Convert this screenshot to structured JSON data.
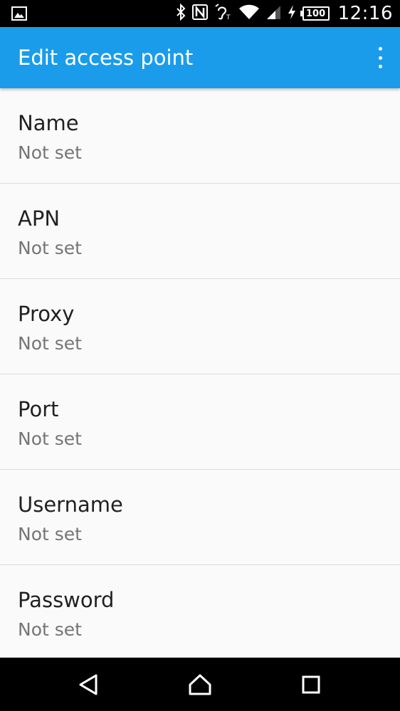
{
  "status_bar": {
    "time": "12:16",
    "battery": "100",
    "icons": [
      "image-icon",
      "bluetooth-icon",
      "nfc-icon",
      "hearing-aid-icon",
      "wifi-icon",
      "signal-icon",
      "charging-icon",
      "battery-icon"
    ]
  },
  "app_bar": {
    "title": "Edit access point",
    "menu_icon": "more-vert-icon"
  },
  "items": [
    {
      "title": "Name",
      "summary": "Not set"
    },
    {
      "title": "APN",
      "summary": "Not set"
    },
    {
      "title": "Proxy",
      "summary": "Not set"
    },
    {
      "title": "Port",
      "summary": "Not set"
    },
    {
      "title": "Username",
      "summary": "Not set"
    },
    {
      "title": "Password",
      "summary": "Not set"
    }
  ],
  "nav_bar": {
    "icons": [
      "back-icon",
      "home-icon",
      "recents-icon"
    ]
  },
  "colors": {
    "app_bar": "#1a9cea",
    "background": "#fafafa",
    "title_text": "#212121",
    "summary_text": "#757575"
  }
}
